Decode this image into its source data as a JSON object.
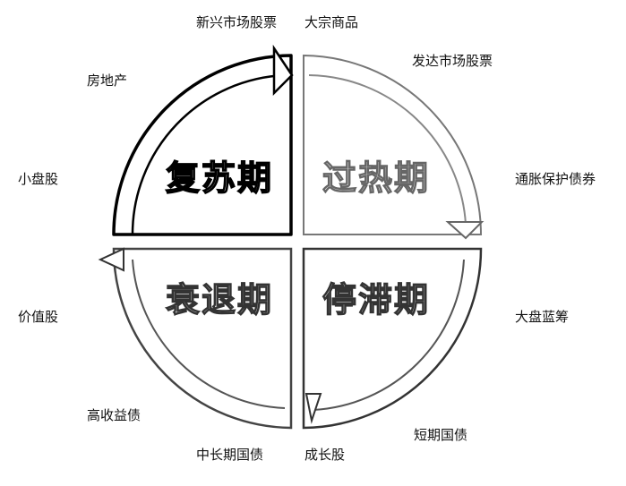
{
  "phases": [
    {
      "id": "recovery",
      "label": "复苏期"
    },
    {
      "id": "overheat",
      "label": "过热期"
    },
    {
      "id": "stagflation",
      "label": "停滞期"
    },
    {
      "id": "recession",
      "label": "衰退期"
    }
  ],
  "assets": {
    "emerging_stocks": "新兴市场股票",
    "commodities": "大宗商品",
    "developed_stocks": "发达市场股票",
    "real_estate": "房地产",
    "small_caps": "小盘股",
    "inflation_protected_bonds": "通胀保护债券",
    "value_stocks": "价值股",
    "large_cap_blue_chips": "大盘蓝筹",
    "high_yield": "高收益债",
    "short_term_treasuries": "短期国债",
    "mid_long_treasuries": "中长期国债",
    "growth_stocks": "成长股"
  }
}
